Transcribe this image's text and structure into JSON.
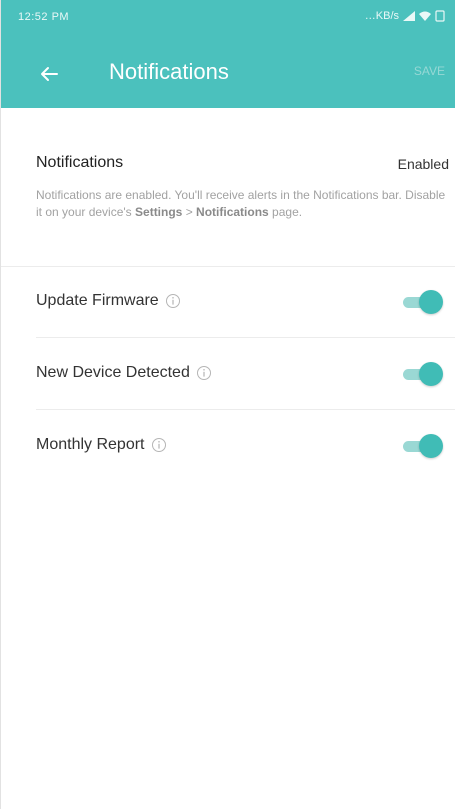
{
  "status_bar": {
    "time": "12:52 PM",
    "right_text": "…KB/s"
  },
  "app_bar": {
    "title": "Notifications",
    "action_label": "SAVE"
  },
  "notifications": {
    "title": "Notifications",
    "status": "Enabled",
    "description_pre": "Notifications are enabled. You'll receive alerts in the Notifications bar. Disable it on your device's ",
    "description_settings": "Settings",
    "description_mid": " > ",
    "description_page": "Notifications",
    "description_post": " page."
  },
  "settings": [
    {
      "label": "Update Firmware",
      "enabled": true
    },
    {
      "label": "New Device Detected",
      "enabled": true
    },
    {
      "label": "Monthly Report",
      "enabled": true
    }
  ],
  "colors": {
    "accent": "#4bc1bd",
    "toggle_on": "#40bcb6"
  }
}
